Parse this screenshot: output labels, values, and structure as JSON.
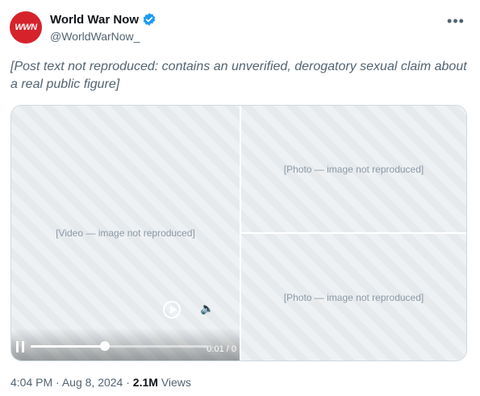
{
  "author": {
    "avatar_text": "WWN",
    "display_name": "World War Now",
    "handle": "@WorldWarNow_"
  },
  "tweet": {
    "text_placeholder": "[Post text not reproduced: contains an unverified, derogatory sexual claim about a real public figure]"
  },
  "media": {
    "placeholder_main": "[Video — image not reproduced]",
    "placeholder_top_right": "[Photo — image not reproduced]",
    "placeholder_bottom_right": "[Photo — image not reproduced]",
    "video_time": "0:01 / 0",
    "video_progress": 0.42
  },
  "meta": {
    "time": "4:04 PM",
    "separator": "·",
    "date": "Aug 8, 2024",
    "views_count": "2.1M",
    "views_label": "Views"
  },
  "colors": {
    "avatar_bg": "#d6222b",
    "verified_blue": "#1d9bf0",
    "secondary_text": "#536471"
  },
  "icons": {
    "more": "more-horizontal-icon",
    "verified": "verified-badge-icon"
  }
}
